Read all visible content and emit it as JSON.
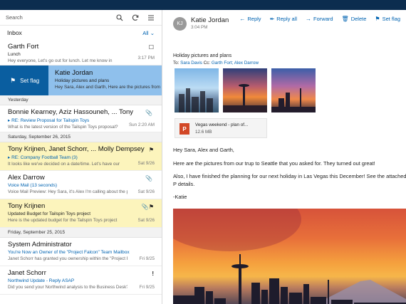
{
  "search": {
    "placeholder": "Search"
  },
  "folder": {
    "title": "Inbox",
    "filter": "All"
  },
  "selected_actions": {
    "flag_label": "Set flag"
  },
  "day_separators": [
    "Yesterday",
    "Saturday, September 26, 2015",
    "Friday, September 25, 2015"
  ],
  "messages": [
    {
      "from": "Garth Fort",
      "subject": "Lunch",
      "preview": "Hey everyone, Let's go out for lunch. Let me know in",
      "time": "3:17 PM"
    },
    {
      "from": "Katie Jordan",
      "subject": "Holiday pictures and plans",
      "preview": "Hey Sara, Alex and Garth, Here are the pictures from"
    },
    {
      "from": "Bonnie Kearney, Aziz Hassouneh, ... Tony",
      "subject": "▸ RE: Review Proposal for Tailspin Toys",
      "preview": "What is the latest version of the Tailspin Toys proposal?",
      "time": "Sun 2:20 AM"
    },
    {
      "from": "Tony Krijnen, Janet Schorr, ... Molly Dempsey",
      "subject": "▸ RE: Company Football Team (3)",
      "preview": "It looks like we've decided on a date/time. Let's have our",
      "time": "Sat 9/26"
    },
    {
      "from": "Alex Darrow",
      "subject": "Voice Mail (13 seconds)",
      "preview": "Voice Mail Preview: Hey Sara, it's Alex I'm calling about the prop",
      "time": "Sat 9/26"
    },
    {
      "from": "Tony Krijnen",
      "subject": "Updated Budget for Tailspin Toys project",
      "preview": "Here is the updated budget for the Tailspin Toys project",
      "time": "Sat 9/26"
    },
    {
      "from": "System Administrator",
      "subject": "You're Now an Owner of the \"Project Falcon\" Team Mailbox",
      "preview": "Janet Schorr has granted you ownership within the \"Project F",
      "time": "Fri 9/25"
    },
    {
      "from": "Janet Schorr",
      "subject": "Northwind Update - Reply ASAP",
      "preview": "Did you send your Northwind analysis to the Business Desk?",
      "time": "Fri 9/25"
    }
  ],
  "toolbar": {
    "reply": "Reply",
    "reply_all": "Reply all",
    "forward": "Forward",
    "delete": "Delete",
    "set_flag": "Set flag"
  },
  "reading": {
    "initials": "KJ",
    "sender": "Katie Jordan",
    "time": "3:04 PM",
    "subject": "Holiday pictures and plans",
    "to_label": "To:",
    "to_names": "Sara Davis",
    "cc_label": "Cc:",
    "cc_names": "Garth Fort; Alex Darrow",
    "attachment_name": "Vegas weekend - plan of...",
    "attachment_size": "12.6 MB",
    "body_1": "Hey Sara, Alex and Garth,",
    "body_2": "Here are the pictures from our trup to Seattle that you asked for. They turned out great!",
    "body_3": "Also, I have finished the planning for our next holiday in Las Vegas this December! See the attached P details.",
    "signature": "-Katie"
  },
  "colors": {
    "accent": "#0063b1",
    "selected": "#8fc0ec",
    "flagged": "#fcf4bc",
    "swipe": "#0a5ea0",
    "topbar": "#0c2d4f"
  }
}
